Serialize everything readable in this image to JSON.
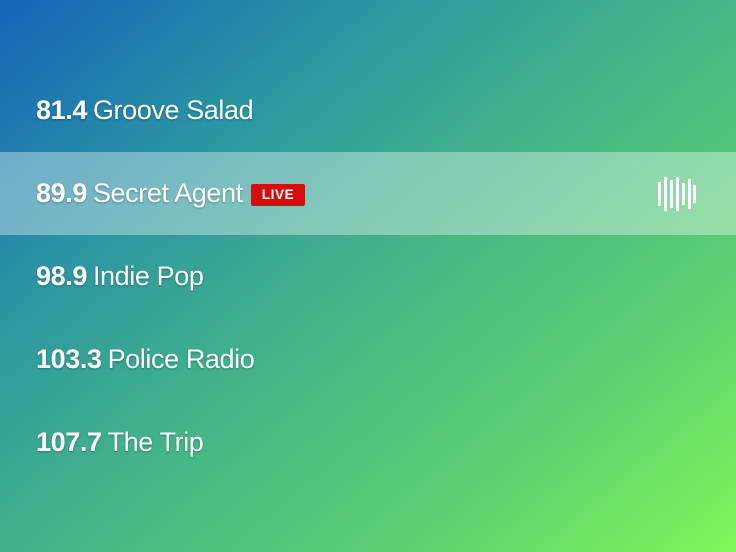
{
  "stations": [
    {
      "frequency": "81.4",
      "name": "Groove Salad",
      "live": false
    },
    {
      "frequency": "89.9",
      "name": "Secret Agent",
      "live": true,
      "badge": "LIVE"
    },
    {
      "frequency": "98.9",
      "name": "Indie Pop",
      "live": false
    },
    {
      "frequency": "103.3",
      "name": "Police Radio",
      "live": false
    },
    {
      "frequency": "107.7",
      "name": "The Trip",
      "live": false
    }
  ],
  "now_playing_indicator": "equalizer-icon",
  "colors": {
    "gradient_start": "#1464b8",
    "gradient_end": "#7ef758",
    "live_badge": "#d40f0f",
    "text": "#ffffff",
    "highlight_row": "rgba(255,255,255,0.36)"
  }
}
